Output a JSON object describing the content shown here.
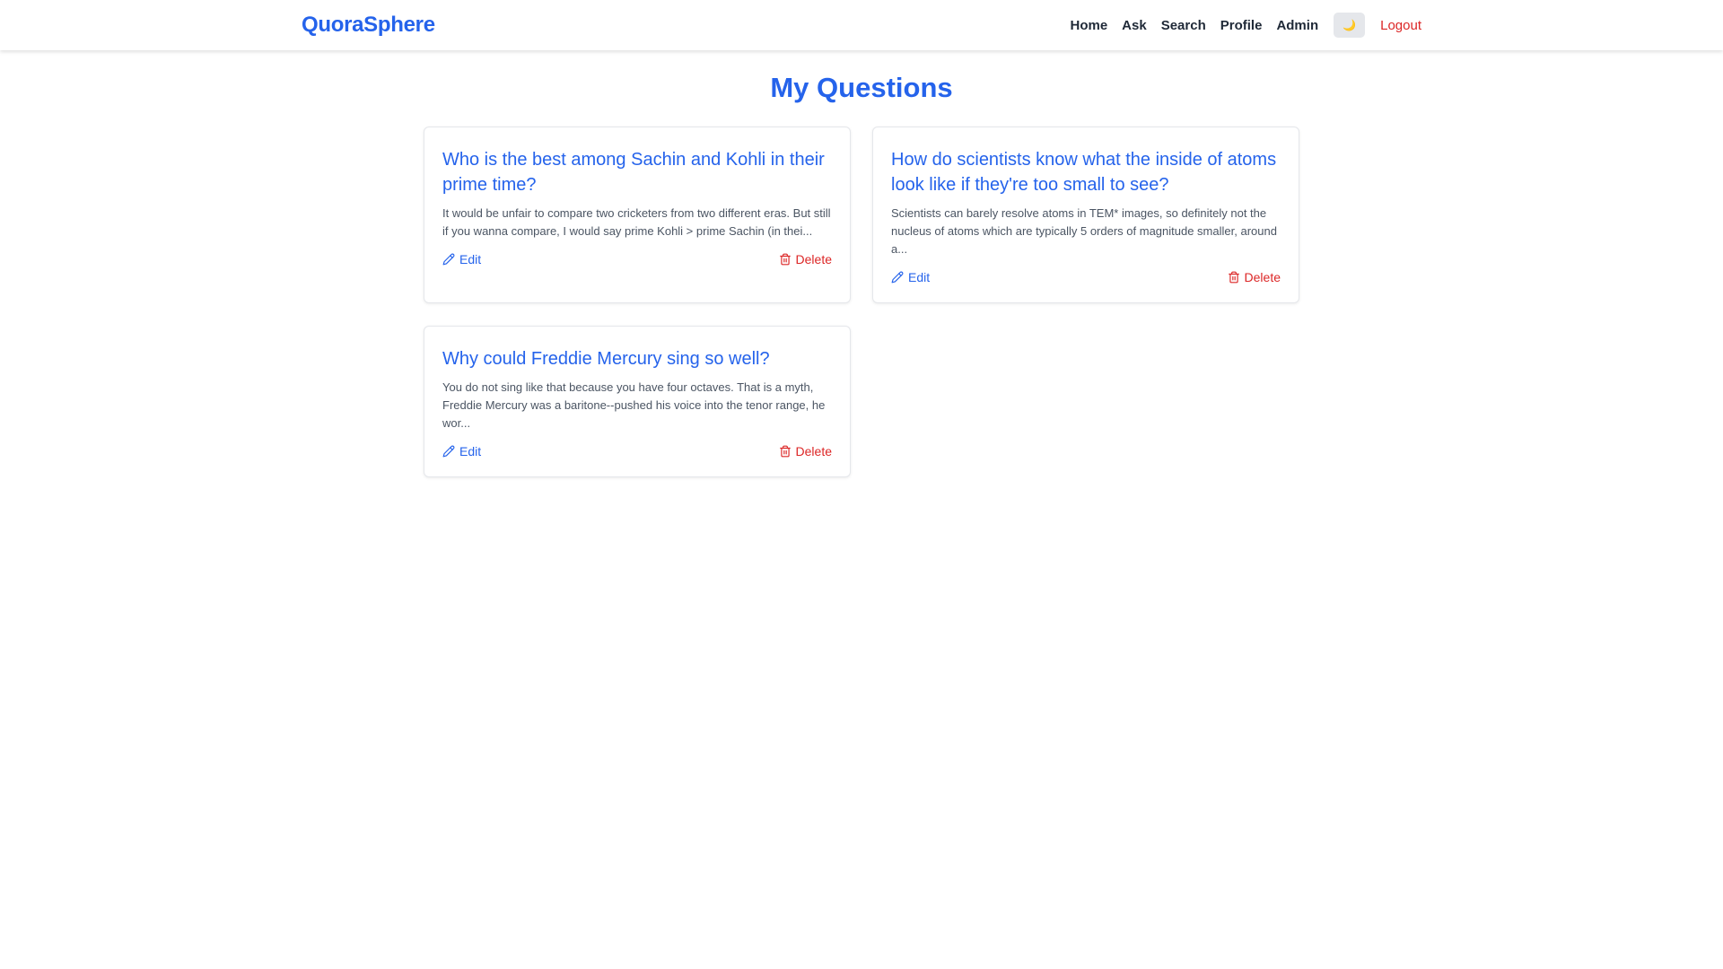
{
  "brand": "QuoraSphere",
  "nav": {
    "home": "Home",
    "ask": "Ask",
    "search": "Search",
    "profile": "Profile",
    "admin": "Admin",
    "theme_icon": "🌙",
    "logout": "Logout"
  },
  "page_title": "My Questions",
  "questions": [
    {
      "title": "Who is the best among Sachin and Kohli in their prime time?",
      "excerpt": "It would be unfair to compare two cricketers from two different eras. But still if you wanna compare, I would say prime Kohli > prime Sachin (in thei...",
      "edit_label": "Edit",
      "delete_label": "Delete"
    },
    {
      "title": "How do scientists know what the inside of atoms look like if they're too small to see?",
      "excerpt": "Scientists can barely resolve atoms in TEM* images, so definitely not the nucleus of atoms which are typically 5 orders of magnitude smaller, around a...",
      "edit_label": "Edit",
      "delete_label": "Delete"
    },
    {
      "title": "Why could Freddie Mercury sing so well?",
      "excerpt": "You do not sing like that because you have four octaves. That is a myth, Freddie Mercury was a baritone--pushed his voice into the tenor range, he wor...",
      "edit_label": "Edit",
      "delete_label": "Delete"
    }
  ],
  "colors": {
    "accent": "#2563eb",
    "danger": "#dc2626",
    "text": "#1f2937",
    "muted": "#4b5563"
  }
}
